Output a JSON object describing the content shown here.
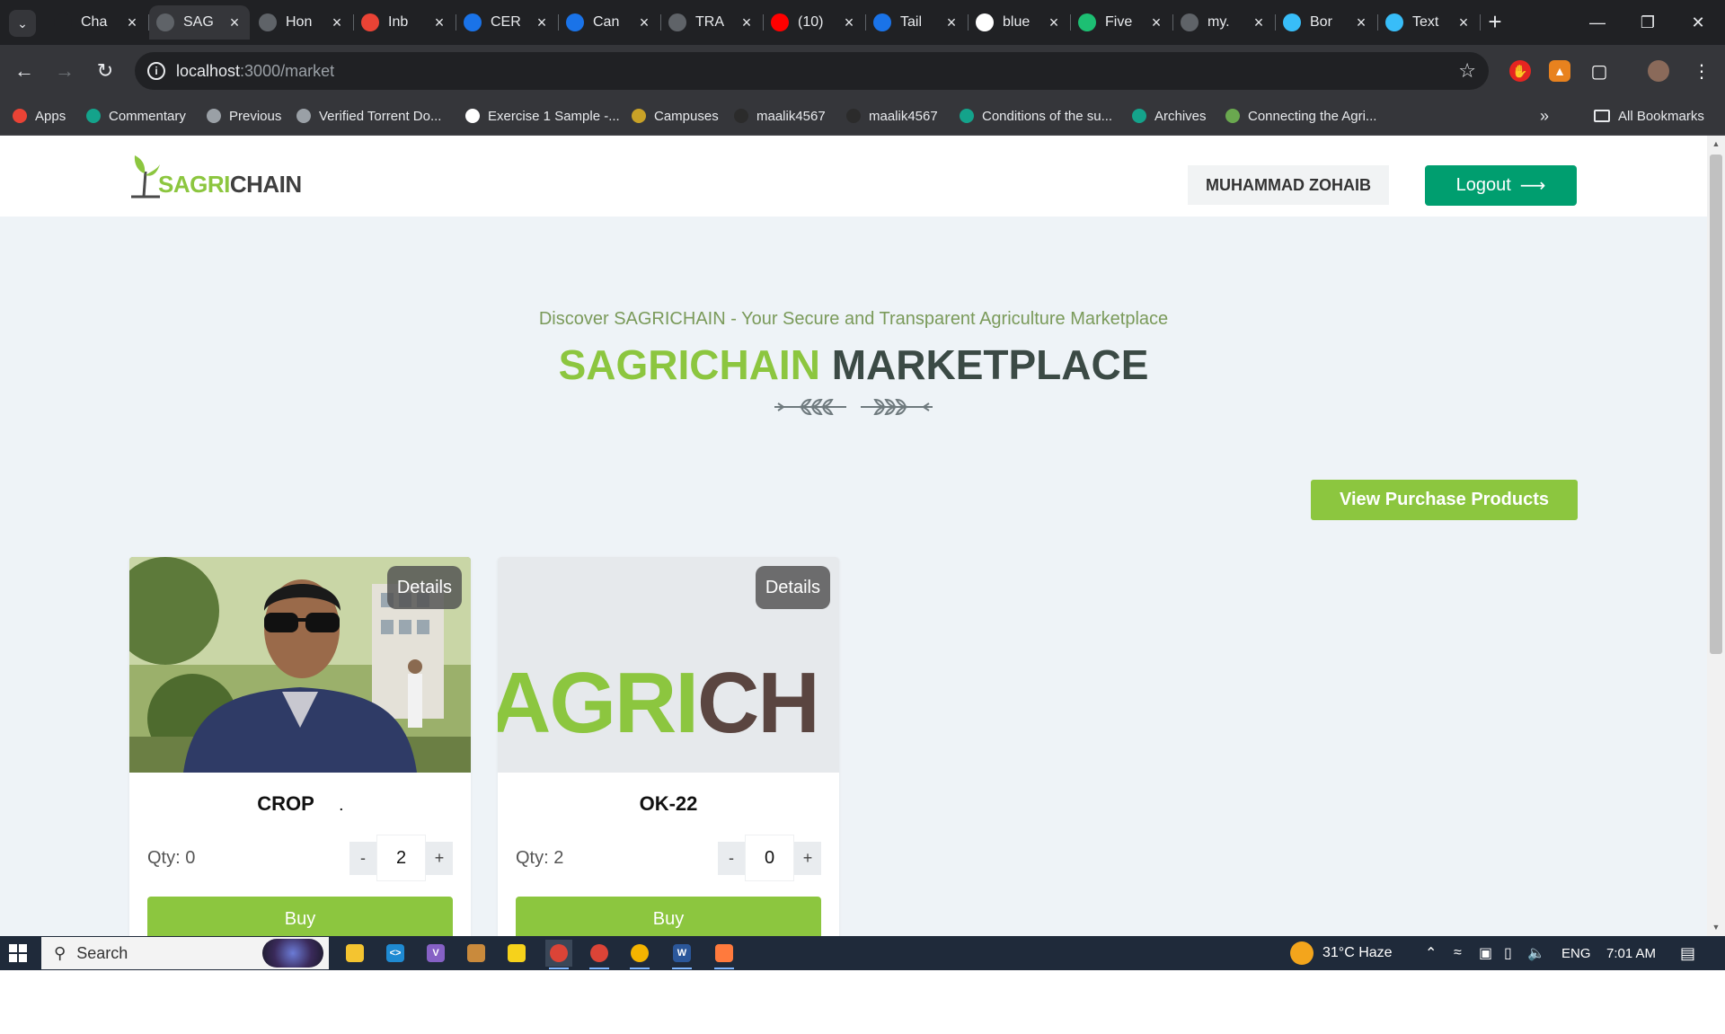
{
  "browser": {
    "tabs": [
      {
        "title": "Cha",
        "favicon": "chatgpt-icon",
        "color": "#202124",
        "active": false
      },
      {
        "title": "SAG",
        "favicon": "globe-icon",
        "color": "#5f6368",
        "active": true
      },
      {
        "title": "Hon",
        "favicon": "globe-icon",
        "color": "#5f6368",
        "active": false
      },
      {
        "title": "Inb",
        "favicon": "gmail-icon",
        "color": "#ea4335",
        "active": false
      },
      {
        "title": "CER",
        "favicon": "cert-icon",
        "color": "#1a73e8",
        "active": false
      },
      {
        "title": "Can",
        "favicon": "info-icon",
        "color": "#1a73e8",
        "active": false
      },
      {
        "title": "TRA",
        "favicon": "globe-icon",
        "color": "#5f6368",
        "active": false
      },
      {
        "title": "(10)",
        "favicon": "youtube-icon",
        "color": "#ff0000",
        "active": false
      },
      {
        "title": "Tail",
        "favicon": "tailwind-play-icon",
        "color": "#1a73e8",
        "active": false
      },
      {
        "title": "blue",
        "favicon": "google-icon",
        "color": "#ffffff",
        "active": false
      },
      {
        "title": "Five",
        "favicon": "fiverr-icon",
        "color": "#1dbf73",
        "active": false
      },
      {
        "title": "my.",
        "favicon": "globe-icon",
        "color": "#5f6368",
        "active": false
      },
      {
        "title": "Bor",
        "favicon": "tailwind-icon",
        "color": "#38bdf8",
        "active": false
      },
      {
        "title": "Text",
        "favicon": "tailwind-icon",
        "color": "#38bdf8",
        "active": false
      }
    ],
    "url_host": "localhost",
    "url_path": ":3000/market",
    "bookmarks": [
      {
        "label": "Apps",
        "icon": "apps-grid-icon",
        "color": "#ea4335"
      },
      {
        "label": "Commentary",
        "icon": "cb-icon",
        "color": "#14a38b"
      },
      {
        "label": "Previous",
        "icon": "globe-icon",
        "color": "#9aa0a6"
      },
      {
        "label": "Verified Torrent Do...",
        "icon": "globe-icon",
        "color": "#9aa0a6"
      },
      {
        "label": "Exercise 1 Sample -...",
        "icon": "exercise-icon",
        "color": "#ffffff"
      },
      {
        "label": "Campuses",
        "icon": "campus-icon",
        "color": "#c9a227"
      },
      {
        "label": "maalik4567",
        "icon": "github-icon",
        "color": "#2b2b2b"
      },
      {
        "label": "maalik4567",
        "icon": "github-icon",
        "color": "#2b2b2b"
      },
      {
        "label": "Conditions of the su...",
        "icon": "cb-icon",
        "color": "#14a38b"
      },
      {
        "label": "Archives",
        "icon": "cb-icon",
        "color": "#14a38b"
      },
      {
        "label": "Connecting the Agri...",
        "icon": "leaf-icon",
        "color": "#6aa84f"
      }
    ],
    "all_bookmarks": "All Bookmarks"
  },
  "site": {
    "logo_green": "SAGRI",
    "logo_dark": "CHAIN",
    "user_name": "MUHAMMAD ZOHAIB",
    "logout_label": "Logout",
    "subtitle": "Discover SAGRICHAIN - Your Secure and Transparent Agriculture Marketplace",
    "title_green": "SAGRICHAIN",
    "title_dark": "MARKETPLACE",
    "view_purchase_label": "View Purchase Products",
    "colors": {
      "brand_green": "#8cc63f",
      "logout_green": "#009e6f",
      "page_bg": "#eef3f7"
    }
  },
  "products": [
    {
      "name": "CROP",
      "name_suffix": ".",
      "details_label": "Details",
      "qty_label": "Qty: 0",
      "stepper_minus": "-",
      "stepper_value": "2",
      "stepper_plus": "+",
      "buy_label": "Buy",
      "image": "person-photo"
    },
    {
      "name": "OK-22",
      "name_suffix": "",
      "details_label": "Details",
      "qty_label": "Qty: 2",
      "stepper_minus": "-",
      "stepper_value": "0",
      "stepper_plus": "+",
      "buy_label": "Buy",
      "image": "logo-banner",
      "image_text_green": "AGRI",
      "image_text_dark": "CH"
    }
  ],
  "taskbar": {
    "search_label": "Search",
    "weather": "31°C  Haze",
    "language": "ENG",
    "time": "7:01 AM"
  }
}
